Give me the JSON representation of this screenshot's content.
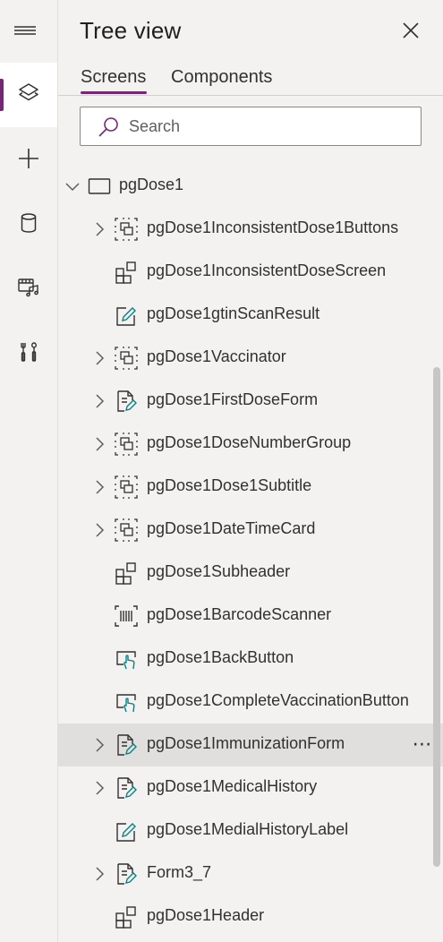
{
  "panel": {
    "title": "Tree view",
    "tabs": [
      {
        "label": "Screens",
        "active": true
      },
      {
        "label": "Components",
        "active": false
      }
    ]
  },
  "search": {
    "placeholder": "Search",
    "value": ""
  },
  "rail": {
    "items": [
      {
        "icon": "layers-icon",
        "active": true
      },
      {
        "icon": "plus-icon",
        "active": false
      },
      {
        "icon": "database-icon",
        "active": false
      },
      {
        "icon": "media-icon",
        "active": false
      },
      {
        "icon": "tools-icon",
        "active": false
      }
    ]
  },
  "colors": {
    "accent": "#742774",
    "selected_row": "#e1dfdd",
    "icon_teal": "#038387"
  },
  "tree": {
    "screen": {
      "label": "pgDose1",
      "icon": "screen-icon",
      "expanded": true
    },
    "items": [
      {
        "label": "pgDose1InconsistentDose1Buttons",
        "icon": "group-icon",
        "expandable": true
      },
      {
        "label": "pgDose1InconsistentDoseScreen",
        "icon": "component-icon",
        "expandable": false
      },
      {
        "label": "pgDose1gtinScanResult",
        "icon": "label-edit-icon",
        "expandable": false
      },
      {
        "label": "pgDose1Vaccinator",
        "icon": "group-icon",
        "expandable": true
      },
      {
        "label": "pgDose1FirstDoseForm",
        "icon": "form-icon",
        "expandable": true
      },
      {
        "label": "pgDose1DoseNumberGroup",
        "icon": "group-icon",
        "expandable": true
      },
      {
        "label": "pgDose1Dose1Subtitle",
        "icon": "group-icon",
        "expandable": true
      },
      {
        "label": "pgDose1DateTimeCard",
        "icon": "group-icon",
        "expandable": true
      },
      {
        "label": "pgDose1Subheader",
        "icon": "component-icon",
        "expandable": false
      },
      {
        "label": "pgDose1BarcodeScanner",
        "icon": "barcode-icon",
        "expandable": false
      },
      {
        "label": "pgDose1BackButton",
        "icon": "button-icon",
        "expandable": false
      },
      {
        "label": "pgDose1CompleteVaccinationButton",
        "icon": "button-icon",
        "expandable": false
      },
      {
        "label": "pgDose1ImmunizationForm",
        "icon": "form-icon",
        "expandable": true,
        "selected": true,
        "more": "⋯"
      },
      {
        "label": "pgDose1MedicalHistory",
        "icon": "form-icon",
        "expandable": true
      },
      {
        "label": "pgDose1MedialHistoryLabel",
        "icon": "label-edit-icon",
        "expandable": false
      },
      {
        "label": "Form3_7",
        "icon": "form-icon",
        "expandable": true
      },
      {
        "label": "pgDose1Header",
        "icon": "component-icon",
        "expandable": false
      }
    ]
  }
}
